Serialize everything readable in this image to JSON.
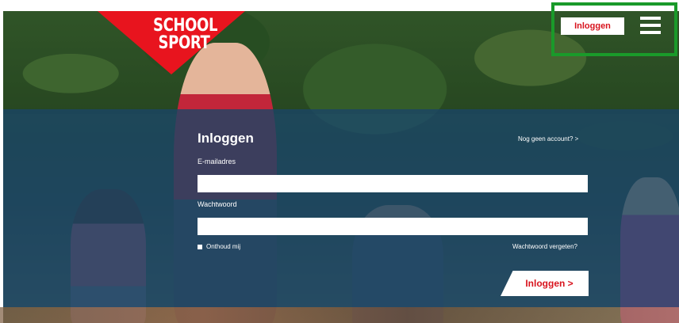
{
  "brand": {
    "logo_line1": "SCHOOL",
    "logo_line2": "SPORT",
    "color": "#e8141e"
  },
  "header": {
    "login_button": "Inloggen",
    "menu_icon": "hamburger-menu-icon"
  },
  "form": {
    "title": "Inloggen",
    "no_account_link": "Nog geen account? >",
    "email_label": "E-mailadres",
    "email_value": "",
    "password_label": "Wachtwoord",
    "password_value": "",
    "remember_label": "Onthoud mij",
    "remember_checked": false,
    "forgot_link": "Wachtwoord vergeten?",
    "submit_label": "Inloggen >"
  },
  "colors": {
    "accent": "#d8141e",
    "panel": "#1a4566",
    "highlight": "#1a9a2a"
  }
}
